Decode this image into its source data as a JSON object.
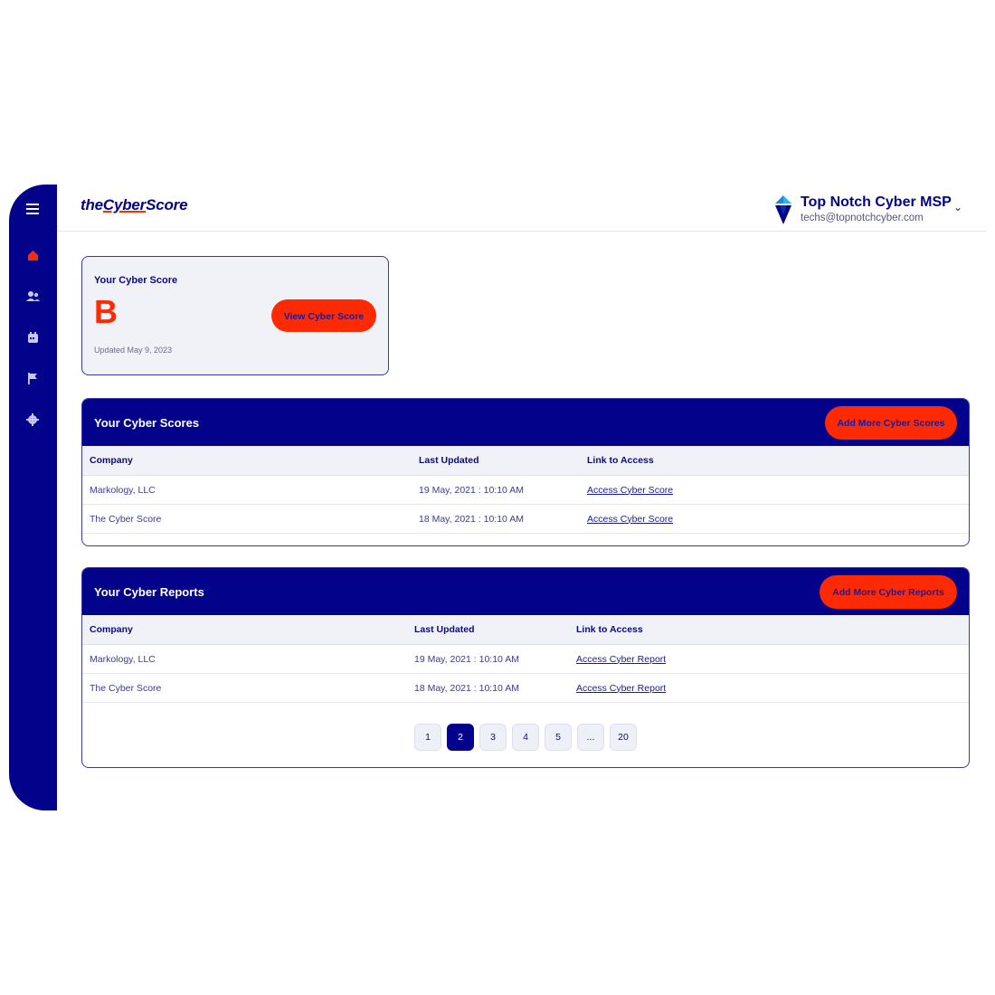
{
  "app": {
    "logo_left": "the",
    "logo_mid": "Cyber",
    "logo_right": "Score"
  },
  "user": {
    "name": "Top Notch Cyber MSP",
    "email": "techs@topnotchcyber.com"
  },
  "sidebar": {
    "items": [
      "menu-icon",
      "home-icon",
      "users-icon",
      "calendar-icon",
      "flag-icon",
      "gear-icon"
    ]
  },
  "score_card": {
    "title": "Your Cyber Score",
    "grade": "B",
    "button": "View Cyber Score",
    "updated": "Updated May 9, 2023"
  },
  "scores": {
    "title": "Your Cyber Scores",
    "button": "Add More Cyber Scores",
    "columns": [
      "Company",
      "Last Updated",
      "Link to Access"
    ],
    "rows": [
      [
        "Markology, LLC",
        "19 May, 2021 : 10:10 AM",
        "Access Cyber Score"
      ],
      [
        "The Cyber Score",
        "18 May, 2021 : 10:10 AM",
        "Access Cyber Score"
      ]
    ]
  },
  "reports": {
    "title": "Your Cyber Reports",
    "button": "Add More Cyber Reports",
    "columns": [
      "Company",
      "Last Updated",
      "Link to Access"
    ],
    "rows": [
      [
        "Markology, LLC",
        "19 May, 2021 : 10:10 AM",
        "Access Cyber Report"
      ],
      [
        "The Cyber Score",
        "18 May, 2021 : 10:10 AM",
        "Access Cyber Report"
      ]
    ]
  },
  "pagination": {
    "pages": [
      "1",
      "2",
      "3",
      "4",
      "5",
      "...",
      "20"
    ],
    "current": "2"
  },
  "colors": {
    "navy": "#02028a",
    "accent_red": "#ff2a00",
    "light_bg": "#f1f2f8"
  }
}
